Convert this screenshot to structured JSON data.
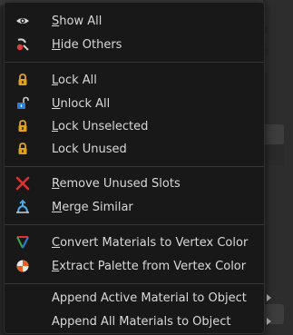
{
  "menu": {
    "items": [
      {
        "label": "Show All",
        "icon": "eye-icon"
      },
      {
        "label": "Hide Others",
        "icon": "hide-others-icon"
      },
      {
        "label": "Lock All",
        "icon": "lock-icon"
      },
      {
        "label": "Unlock All",
        "icon": "unlock-icon"
      },
      {
        "label": "Lock Unselected",
        "icon": "lock-icon"
      },
      {
        "label": "Lock Unused",
        "icon": "lock-icon"
      },
      {
        "label": "Remove Unused Slots",
        "icon": "x-icon"
      },
      {
        "label": "Merge Similar",
        "icon": "merge-icon"
      },
      {
        "label": "Convert Materials to Vertex Color",
        "icon": "vertex-color-icon"
      },
      {
        "label": "Extract Palette from Vertex Color",
        "icon": "palette-icon"
      },
      {
        "label": "Append Active Material to Object",
        "icon": ""
      },
      {
        "label": "Append All Materials to Object",
        "icon": ""
      }
    ]
  },
  "colors": {
    "lock": "#e0a020",
    "remove": "#e03030",
    "accent_blue": "#2d7bd3"
  }
}
